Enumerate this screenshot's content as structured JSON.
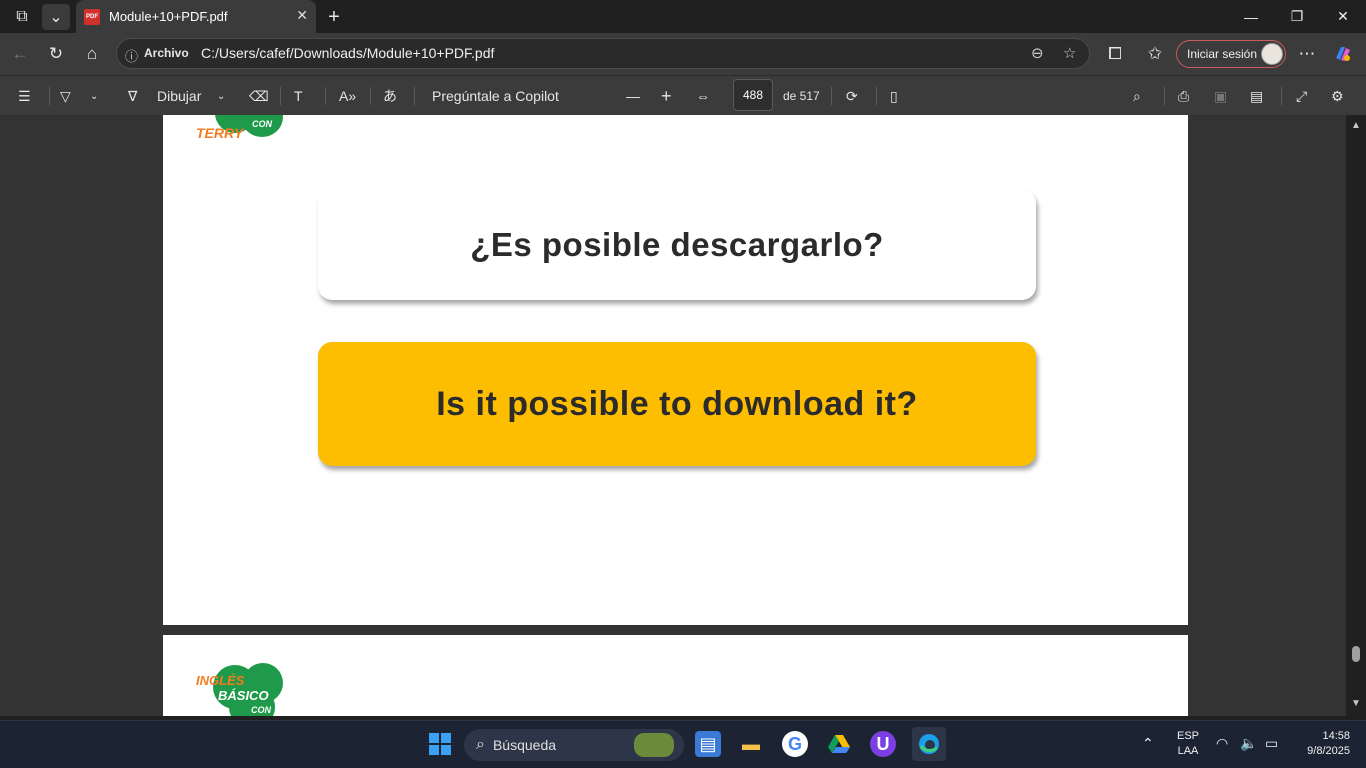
{
  "window": {
    "tab_title": "Module+10+PDF.pdf",
    "pdf_badge": "PDF"
  },
  "address": {
    "site_label": "Archivo",
    "url": "C:/Users/cafef/Downloads/Module+10+PDF.pdf",
    "signin_label": "Iniciar sesión"
  },
  "pdf_toolbar": {
    "draw_label": "Dibujar",
    "copilot_label": "Pregúntale a Copilot",
    "page_current": "488",
    "page_total_label": "de 517"
  },
  "document": {
    "logo_text_top": "TERRY",
    "logo_con": "CON",
    "logo2_ing": "INGLÉS",
    "logo2_basico": "BÁSICO",
    "logo2_con": "CON",
    "card_spanish": "¿Es posible descargarlo?",
    "card_english": "Is it possible to download it?"
  },
  "taskbar": {
    "search_placeholder": "Búsqueda",
    "lang_top": "ESP",
    "lang_bottom": "LAA",
    "time": "14:58",
    "date": "9/8/2025"
  },
  "colors": {
    "card_yellow": "#fdbd00",
    "logo_green": "#1f9a4a",
    "logo_orange": "#f47b20"
  }
}
